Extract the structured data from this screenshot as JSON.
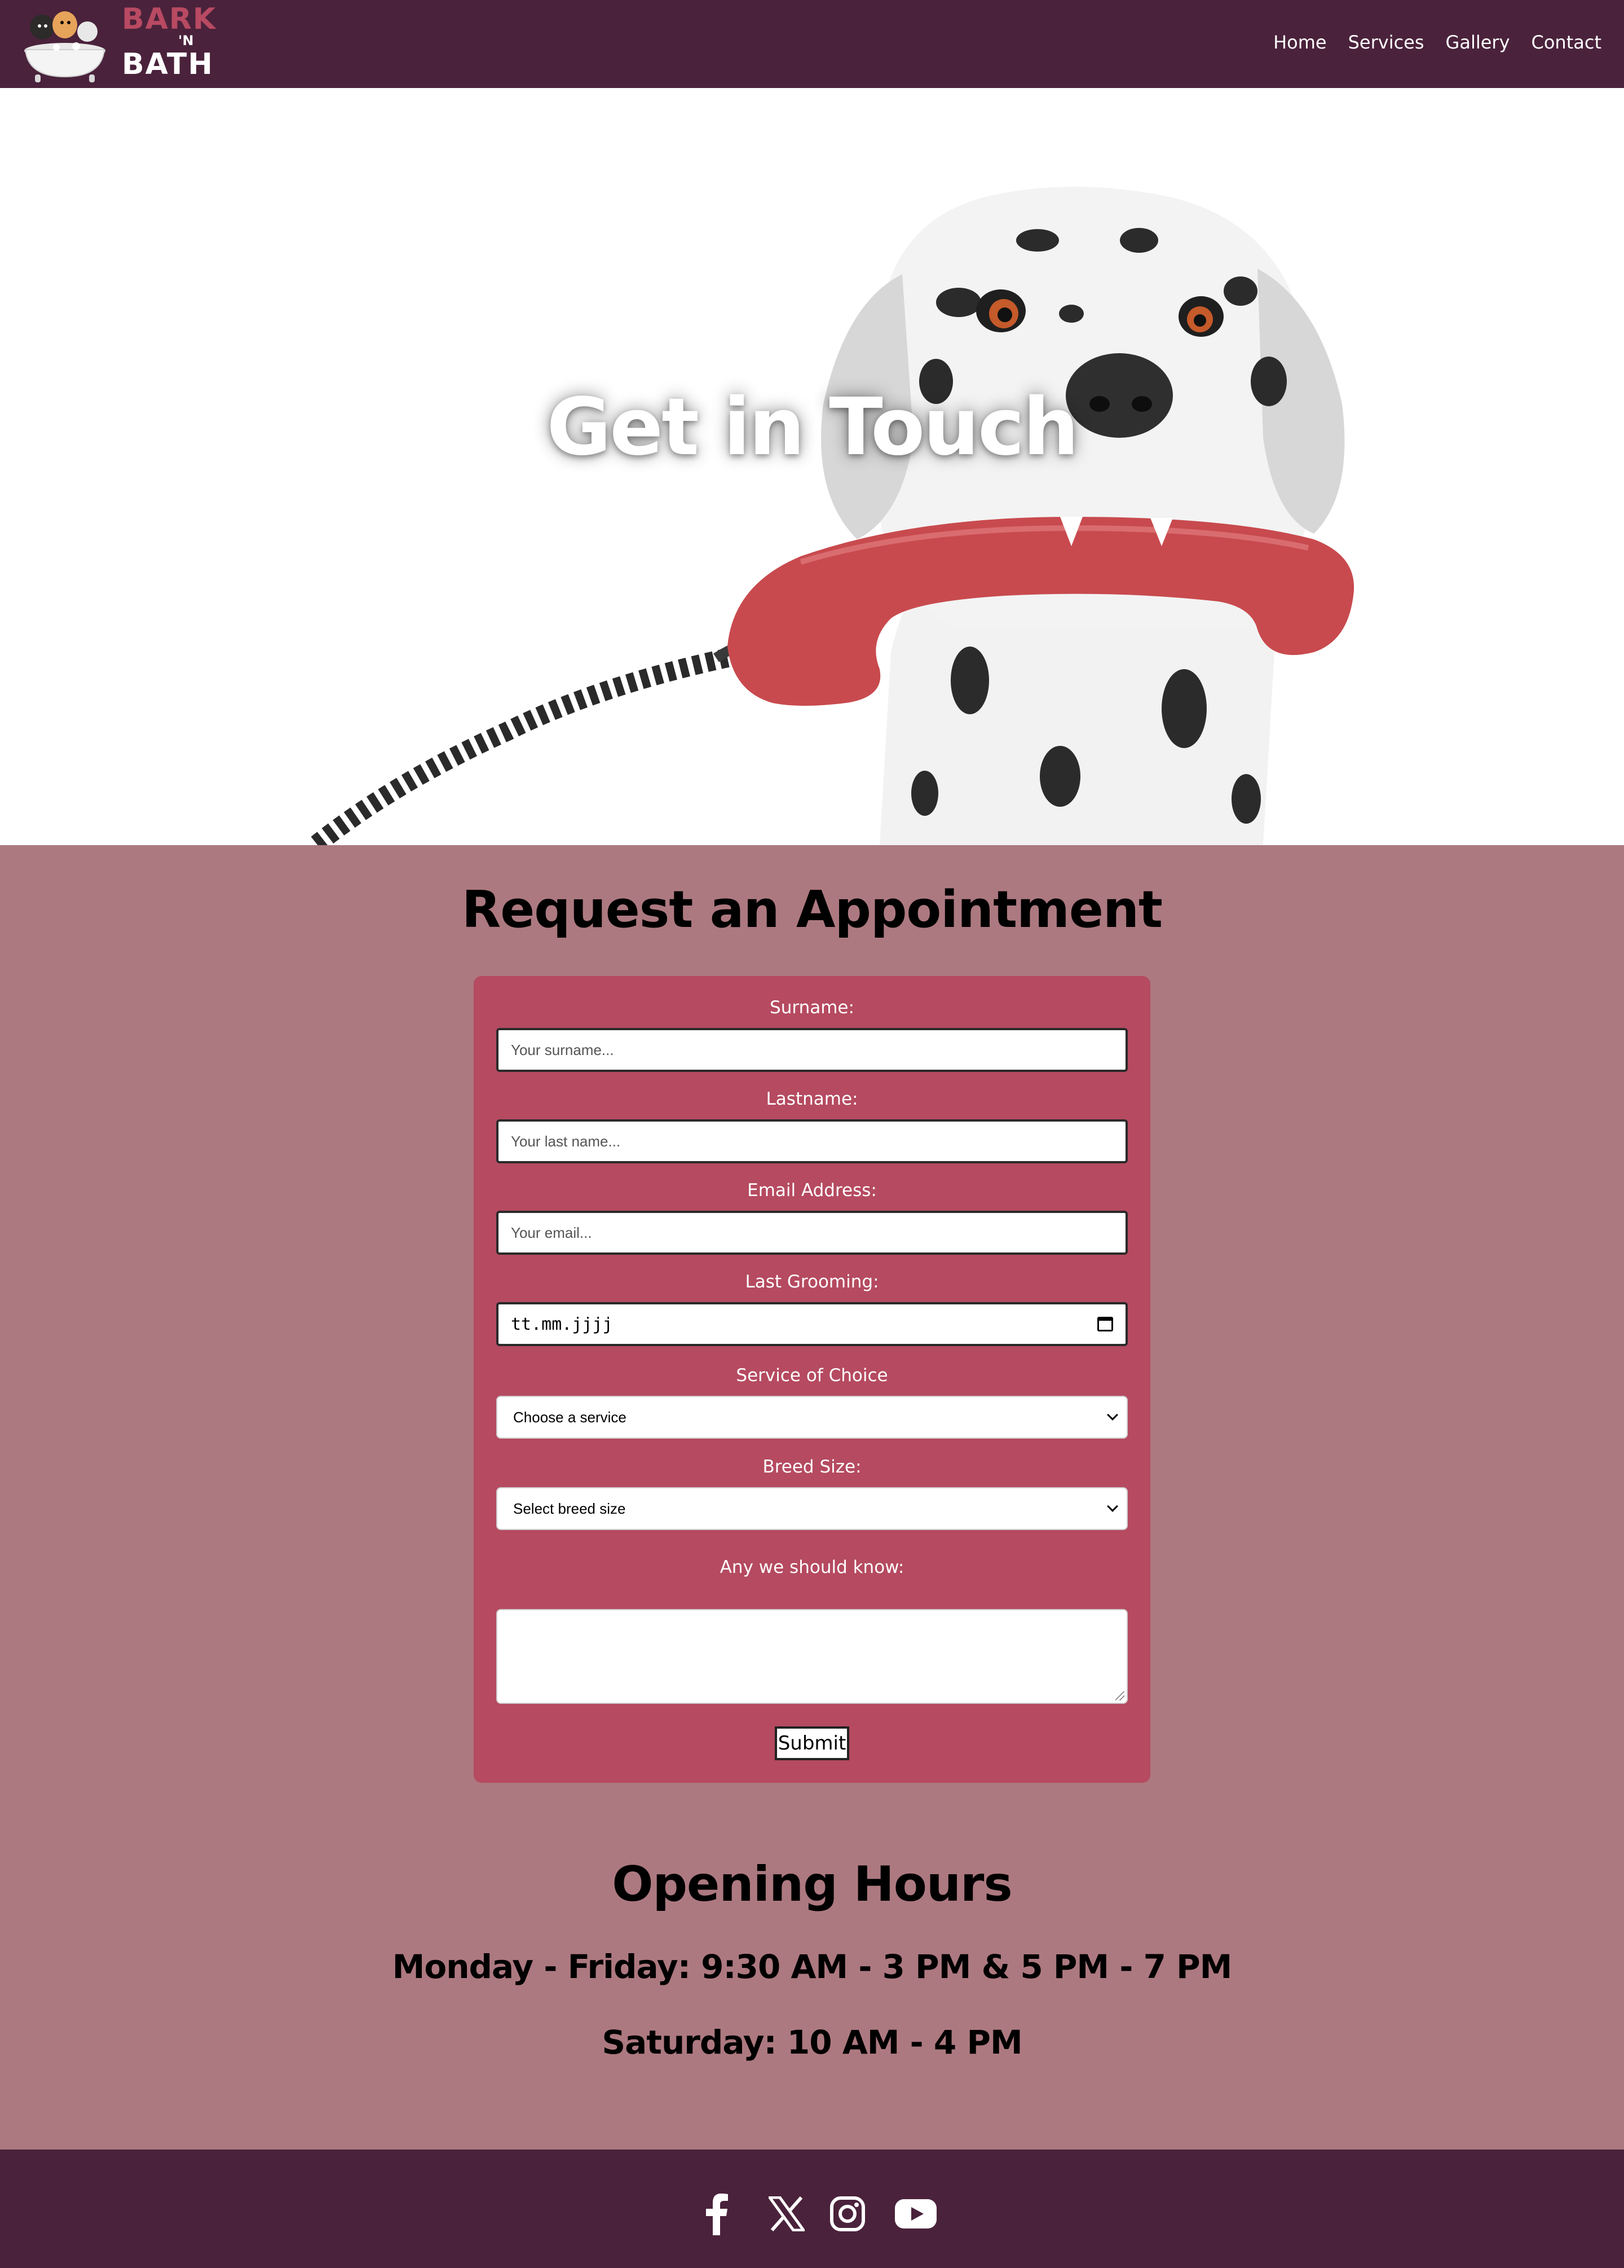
{
  "brand": {
    "line1": "BARK",
    "line2": "'N",
    "line3": "BATH"
  },
  "nav": {
    "items": [
      {
        "label": "Home"
      },
      {
        "label": "Services"
      },
      {
        "label": "Gallery"
      },
      {
        "label": "Contact"
      }
    ]
  },
  "hero": {
    "title": "Get in Touch"
  },
  "appointment": {
    "title": "Request an Appointment",
    "surname_label": "Surname:",
    "surname_placeholder": "Your surname...",
    "lastname_label": "Lastname:",
    "lastname_placeholder": "Your last name...",
    "email_label": "Email Address:",
    "email_placeholder": "Your email...",
    "last_grooming_label": "Last Grooming:",
    "last_grooming_value": "tt.mm.jjjj",
    "service_label": "Service of Choice",
    "service_selected": "Choose a service",
    "breed_label": "Breed Size:",
    "breed_selected": "Select breed size",
    "notes_label": "Any we should know:",
    "notes_value": "",
    "submit_label": "Submit"
  },
  "hours": {
    "title": "Opening Hours",
    "weekdays": "Monday - Friday: 9:30 AM - 3 PM & 5 PM - 7 PM",
    "saturday": "Saturday: 10 AM - 4 PM"
  },
  "footer": {
    "icons": [
      "facebook-icon",
      "x-icon",
      "instagram-icon",
      "youtube-icon"
    ]
  },
  "colors": {
    "navbar": "#4a223b",
    "page": "#ad7980",
    "form": "#b54a60",
    "brand_pink": "#b84a62",
    "phone_red": "#c84a4e"
  }
}
